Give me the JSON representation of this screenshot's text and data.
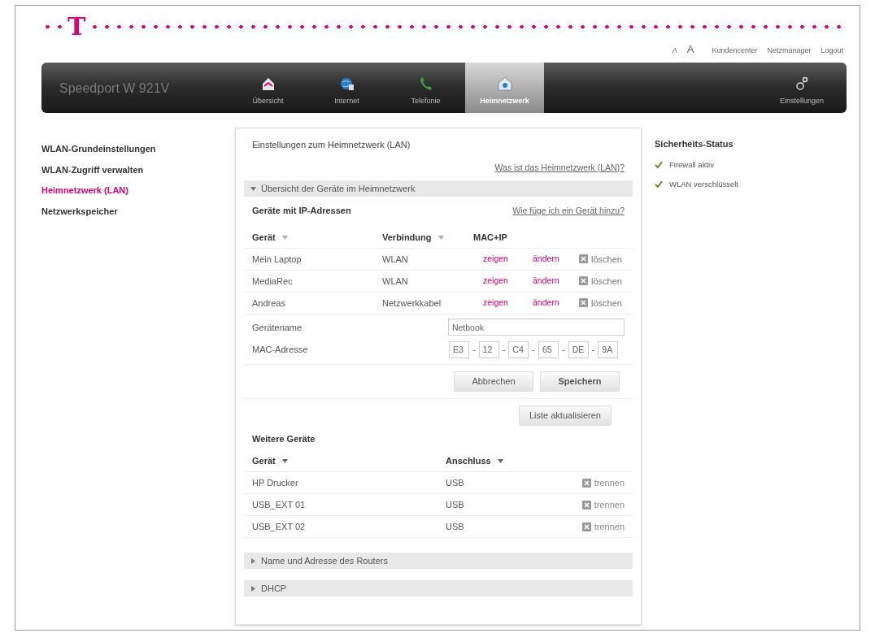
{
  "logo": {
    "text": "T"
  },
  "top_links": [
    {
      "label": "A",
      "kind": "small"
    },
    {
      "label": "A",
      "kind": "large"
    },
    {
      "label": "Kundencenter",
      "kind": "link"
    },
    {
      "label": "Netzmanager",
      "kind": "link"
    },
    {
      "label": "Logout",
      "kind": "link"
    }
  ],
  "brand": "Speedport W 921V",
  "nav": [
    {
      "label": "Übersicht",
      "selected": false
    },
    {
      "label": "Internet",
      "selected": false
    },
    {
      "label": "Telefonie",
      "selected": false
    },
    {
      "label": "Heimnetzwerk",
      "selected": true
    },
    {
      "label": "Einstellungen",
      "selected": false
    }
  ],
  "sidebar": [
    {
      "label": "WLAN-Grundeinstellungen",
      "selected": false
    },
    {
      "label": "WLAN-Zugriff verwalten",
      "selected": false
    },
    {
      "label": "Heimnetzwerk (LAN)",
      "selected": true
    },
    {
      "label": "Netzwerkspeicher",
      "selected": false
    }
  ],
  "main": {
    "title": "Einstellungen zum Heimnetzwerk (LAN)",
    "help_link": "Was ist das Heimnetzwerk (LAN)?",
    "sections": [
      {
        "title": "Übersicht der Geräte im Heimnetzwerk",
        "expanded": true,
        "devices": {
          "heading": "Geräte mit IP-Adressen",
          "help_link": "Wie füge ich ein Gerät hinzu?",
          "columns": [
            "Gerät",
            "Verbindung",
            "MAC+IP"
          ],
          "rows": [
            {
              "name": "Mein Laptop",
              "connection": "WLAN",
              "show": "zeigen",
              "edit": "ändern",
              "delete": "löschen"
            },
            {
              "name": "MediaRec",
              "connection": "WLAN",
              "show": "zeigen",
              "edit": "ändern",
              "delete": "löschen"
            },
            {
              "name": "Andreas",
              "connection": "Netzwerkkabel",
              "show": "zeigen",
              "edit": "ändern",
              "delete": "löschen"
            }
          ],
          "form": {
            "name_label": "Gerätename",
            "name_value": "Netbook",
            "mac_label": "MAC-Adresse",
            "mac": [
              {
                "value": "E3"
              },
              {
                "sep": "-",
                "value": "12"
              },
              {
                "sep": "-",
                "value": "C4"
              },
              {
                "sep": "-",
                "value": "65"
              },
              {
                "sep": "-",
                "value": "DE"
              },
              {
                "sep": "-",
                "value": "9A"
              }
            ],
            "cancel": "Abbrechen",
            "save": "Speichern"
          },
          "refresh": "Liste aktualisieren"
        },
        "others": {
          "heading": "Weitere Geräte",
          "columns": [
            "Gerät",
            "Anschluss"
          ],
          "rows": [
            {
              "name": "HP Drucker",
              "port": "USB",
              "action": "trennen"
            },
            {
              "name": "USB_EXT 01",
              "port": "USB",
              "action": "trennen"
            },
            {
              "name": "USB_EXT 02",
              "port": "USB",
              "action": "trennen"
            }
          ]
        }
      },
      {
        "title": "Name und Adresse des Routers",
        "expanded": false
      },
      {
        "title": "DHCP",
        "expanded": false
      }
    ]
  },
  "status": {
    "title": "Sicherheits-Status",
    "items": [
      "Firewall aktiv",
      "WLAN verschlüsselt"
    ]
  }
}
